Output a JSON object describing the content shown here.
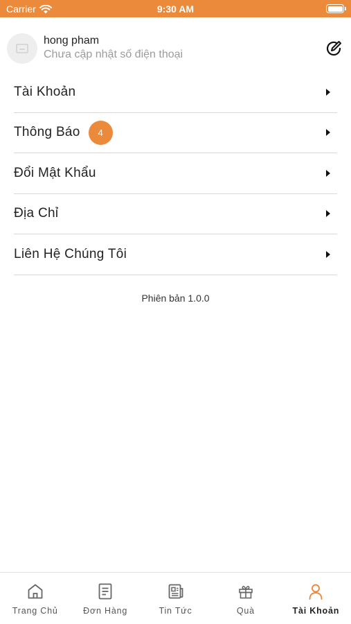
{
  "status_bar": {
    "carrier": "Carrier",
    "time": "9:30 AM"
  },
  "profile": {
    "name": "hong pham",
    "phone": "Chưa cập nhật số điện thoại"
  },
  "menu": {
    "items": [
      {
        "label": "Tài Khoản"
      },
      {
        "label": "Thông Báo",
        "badge": "4"
      },
      {
        "label": "Đổi Mật Khẩu"
      },
      {
        "label": "Địa Chỉ"
      },
      {
        "label": "Liên Hệ Chúng Tôi"
      }
    ]
  },
  "version": "Phiên bản 1.0.0",
  "tabs": [
    {
      "label": "Trang Chủ",
      "icon": "home-icon"
    },
    {
      "label": "Đơn Hàng",
      "icon": "orders-icon"
    },
    {
      "label": "Tin Tức",
      "icon": "news-icon"
    },
    {
      "label": "Quà",
      "icon": "gift-icon"
    },
    {
      "label": "Tài Khoản",
      "icon": "user-icon",
      "active": true
    }
  ],
  "colors": {
    "accent": "#ec8a3c",
    "divider": "#d8d8d8",
    "muted_text": "#9b9b9b"
  }
}
